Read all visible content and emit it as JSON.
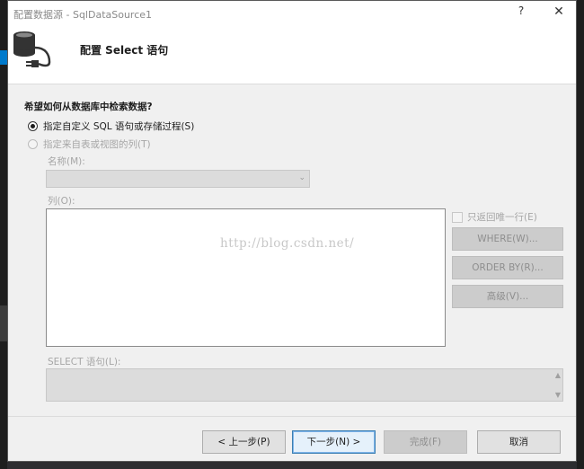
{
  "window": {
    "title": "配置数据源 - SqlDataSource1",
    "help_glyph": "?",
    "close_glyph": "✕"
  },
  "header": {
    "title": "配置 Select 语句",
    "icon": "database-connector-icon"
  },
  "form": {
    "question": "希望如何从数据库中检索数据?",
    "option_custom": "指定自定义 SQL 语句或存储过程(S)",
    "option_table": "指定来自表或视图的列(T)",
    "name_label": "名称(M):",
    "columns_label": "列(O):",
    "unique_rows_label": "只返回唯一行(E)",
    "where_button": "WHERE(W)...",
    "orderby_button": "ORDER BY(R)...",
    "advanced_button": "高级(V)...",
    "select_label": "SELECT 语句(L):",
    "watermark": "http://blog.csdn.net/"
  },
  "footer": {
    "prev": "< 上一步(P)",
    "next": "下一步(N) >",
    "finish": "完成(F)",
    "cancel": "取消"
  },
  "colors": {
    "dialog_bg": "#f0f0f0",
    "primary_border": "#3c7fb1",
    "disabled_text": "#a6a6a6"
  }
}
